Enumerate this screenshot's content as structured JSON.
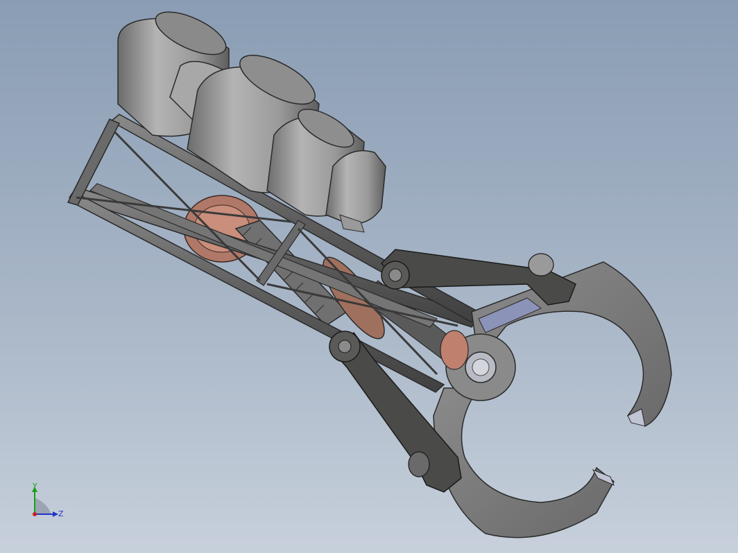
{
  "triad": {
    "y_label": "Y",
    "z_label": "Z",
    "colors": {
      "y": "#1aa01a",
      "z": "#2333c8",
      "x": "#c81e1e"
    }
  },
  "model": {
    "parts": [
      "motor-housing",
      "truss-frame",
      "gear-train",
      "linkage-arm-upper",
      "linkage-arm-lower",
      "gripper-claw"
    ],
    "colors": {
      "motor": "#9a9a9a",
      "frame": "#6b6b6b",
      "claw": "#7a7a7a",
      "gear": "#b07868",
      "link": "#4a4a48"
    }
  }
}
